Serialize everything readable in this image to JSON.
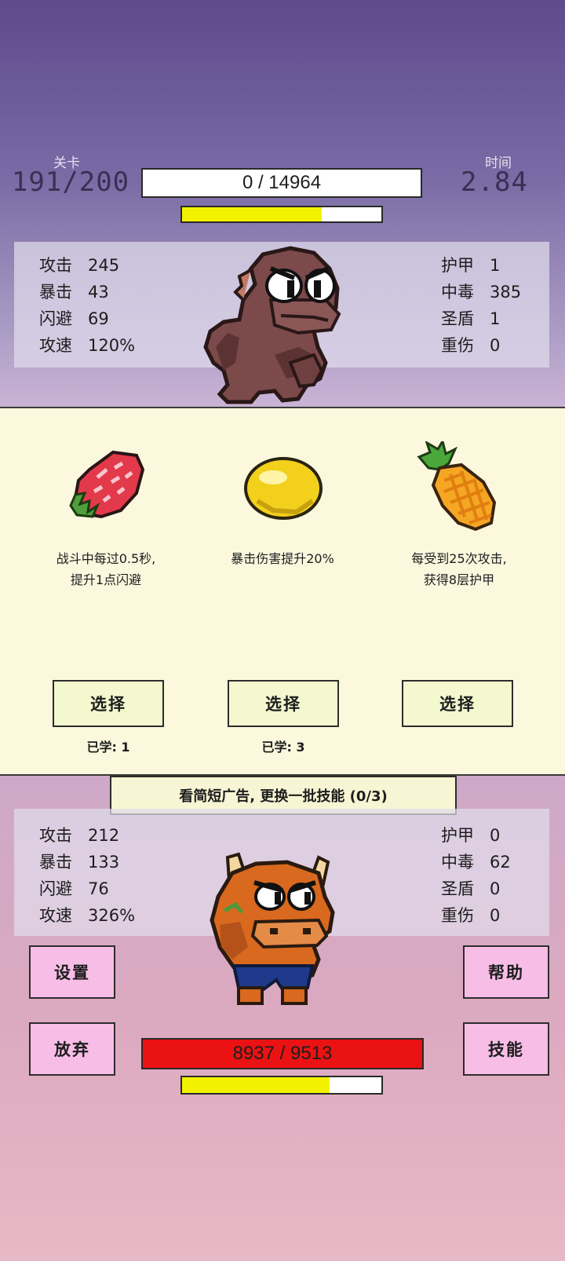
{
  "header": {
    "level_label": "关卡",
    "level_value": "191/200",
    "time_label": "时间",
    "time_value": "2.84",
    "enemy_hp_text": "0 / 14964",
    "enemy_energy_fraction": 0.7
  },
  "enemy_stats": {
    "left": [
      {
        "key": "攻击",
        "value": "245"
      },
      {
        "key": "暴击",
        "value": "43"
      },
      {
        "key": "闪避",
        "value": "69"
      },
      {
        "key": "攻速",
        "value": "120%"
      }
    ],
    "right": [
      {
        "key": "护甲",
        "value": "1"
      },
      {
        "key": "中毒",
        "value": "385"
      },
      {
        "key": "圣盾",
        "value": "1"
      },
      {
        "key": "重伤",
        "value": "0"
      }
    ]
  },
  "skill_cards": [
    {
      "icon": "strawberry-icon",
      "desc_line1": "战斗中每过0.5秒,",
      "desc_line2": "提升1点闪避",
      "button": "选择",
      "learned": "已学: 1"
    },
    {
      "icon": "lemon-icon",
      "desc_line1": "暴击伤害提升20%",
      "desc_line2": "",
      "button": "选择",
      "learned": "已学: 3"
    },
    {
      "icon": "pineapple-icon",
      "desc_line1": "每受到25次攻击,",
      "desc_line2": "获得8层护甲",
      "button": "选择",
      "learned": ""
    }
  ],
  "ad_button": "看简短广告, 更换一批技能 (0/3)",
  "player_stats": {
    "left": [
      {
        "key": "攻击",
        "value": "212"
      },
      {
        "key": "暴击",
        "value": "133"
      },
      {
        "key": "闪避",
        "value": "76"
      },
      {
        "key": "攻速",
        "value": "326%"
      }
    ],
    "right": [
      {
        "key": "护甲",
        "value": "0"
      },
      {
        "key": "中毒",
        "value": "62"
      },
      {
        "key": "圣盾",
        "value": "0"
      },
      {
        "key": "重伤",
        "value": "0"
      }
    ]
  },
  "buttons": {
    "settings": "设置",
    "help": "帮助",
    "give_up": "放弃",
    "skills": "技能"
  },
  "player_hp_text": "8937 / 9513",
  "player_hp_fraction": 0.939,
  "player_energy_fraction": 0.74,
  "colors": {
    "hp_red": "#ea1212",
    "energy_yellow": "#f2f200",
    "card_bg": "#fbf8de",
    "pink_button": "#f8bde6"
  }
}
